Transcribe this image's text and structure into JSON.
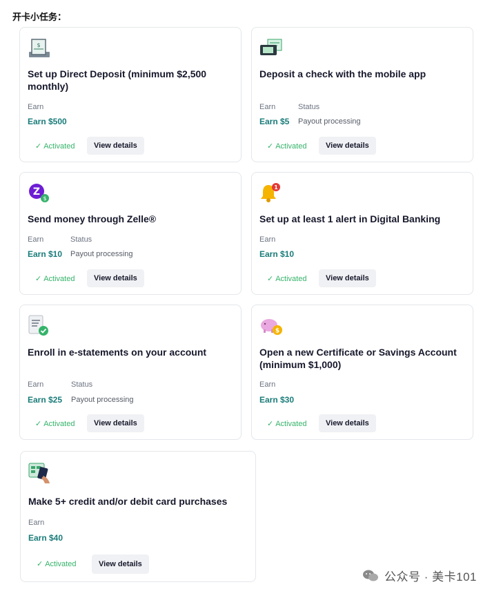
{
  "heading": "开卡小任务：",
  "common": {
    "earn_label": "Earn",
    "status_label": "Status",
    "activated_label": "Activated",
    "view_details_label": "View details"
  },
  "tasks": [
    {
      "title": "Set up Direct Deposit (minimum $2,500 monthly)",
      "earn": "Earn $500",
      "status": null,
      "icon": "direct-deposit-icon"
    },
    {
      "title": "Deposit a check with the mobile app",
      "earn": "Earn $5",
      "status": "Payout processing",
      "icon": "mobile-check-icon"
    },
    {
      "title": "Send money through Zelle®",
      "earn": "Earn $10",
      "status": "Payout processing",
      "icon": "zelle-icon"
    },
    {
      "title": "Set up at least 1 alert in Digital Banking",
      "earn": "Earn $10",
      "status": null,
      "icon": "bell-alert-icon"
    },
    {
      "title": "Enroll in e-statements on your account",
      "earn": "Earn $25",
      "status": "Payout processing",
      "icon": "e-statement-icon"
    },
    {
      "title": "Open a new Certificate or Savings Account (minimum $1,000)",
      "earn": "Earn $30",
      "status": null,
      "icon": "piggy-bank-icon"
    },
    {
      "title": "Make 5+ credit and/or debit card purchases",
      "earn": "Earn $40",
      "status": null,
      "icon": "card-purchase-icon"
    }
  ],
  "watermark": "公众号 · 美卡101",
  "colors": {
    "earn": "#1a7c7a",
    "activated": "#35b36a",
    "card_border": "#e3e6ea"
  }
}
